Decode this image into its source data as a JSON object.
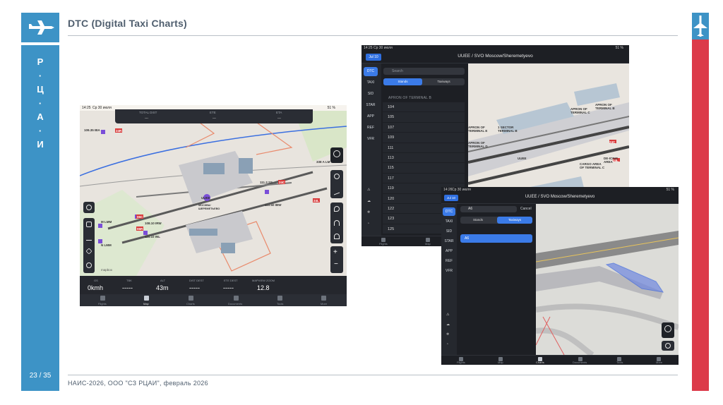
{
  "slide": {
    "title": "DTC (Digital Taxi Charts)",
    "side_letters": [
      "Р",
      "·",
      "Ц",
      "·",
      "А",
      "·",
      "И"
    ],
    "page_number": "23 / 35",
    "footer": "НАИС-2026, ООО \"СЗ РЦАИ\",  февраль 2026",
    "colors": {
      "accent_blue": "#3d93c6",
      "accent_red": "#dc3a49"
    }
  },
  "screen_map": {
    "status": {
      "time": "14:25",
      "date": "Ср 30 июля",
      "battery": "51 %"
    },
    "top_info": {
      "labels": [
        "TOTAL DIST",
        "ETE",
        "ETA"
      ],
      "values": [
        "---",
        "---",
        "---"
      ]
    },
    "map_labels": {
      "left_top": "109.35 IBA",
      "rwy1": "24R",
      "rwy2": "24C",
      "rwy3": "24L",
      "rwy4": "06C",
      "rwy5": "06R",
      "airport_code": "UUEE",
      "airport_name": "МОСКВА/ ШЕРЕМЕТЬЕВО",
      "ils1": "111.3 SS",
      "ils2": "338 A LM",
      "ils3": "110.50 IBW",
      "ils4": "108.10 IRW",
      "ils5": "110.10 INL",
      "lmm1": "M LMM",
      "lmm2": "N LMM",
      "mapbox": "mapbox"
    },
    "bottom_info": {
      "labels": [
        "GS",
        "TBK",
        "ALT",
        "DIST DEST",
        "ETE DEST",
        "MAPVIEW ZOOM"
      ],
      "values": [
        "0kmh",
        "-----",
        "43m",
        "-----",
        "-----",
        "12.8"
      ]
    },
    "tabs": [
      "Flights",
      "Map",
      "Charts",
      "Documents",
      "Tools",
      "More"
    ]
  },
  "screen_dtc": {
    "status": {
      "time": "14:25",
      "date": "Ср 30 июля",
      "battery": "51 %"
    },
    "date_button": "Jul 10",
    "header_title": "UUEE / SVO Moscow/Sheremetyevo",
    "rail": [
      "DTC",
      "TAXI",
      "SID",
      "STAR",
      "APP",
      "REF",
      "VFR"
    ],
    "search_placeholder": "Search",
    "segments": [
      "Stands",
      "Taxiways"
    ],
    "section": "APRON OF TERMINAL B",
    "stands": [
      "104",
      "105",
      "107",
      "109",
      "111",
      "113",
      "115",
      "117",
      "119",
      "120",
      "122",
      "123",
      "125"
    ],
    "map_labels": {
      "apron_b": "APRON OF TERMINAL B",
      "apron_c": "APRON OF TERMINAL C",
      "apron_e": "APRON OF TERMINAL E",
      "sector_b": "1 SECTOR TERMINAL B",
      "apron_d": "APRON OF TERMINAL D",
      "cargo": "CARGO AREA OF TERMINAL C",
      "deicing": "DE-ICING AREA",
      "uuee": "UUEE",
      "r24c": "24C",
      "r24l": "24L"
    },
    "tabs": [
      "Flights",
      "Map"
    ]
  },
  "screen_taxi": {
    "status": {
      "time": "14:26",
      "date": "Ср 30 июля",
      "battery": "51 %"
    },
    "date_button": "Jul 10",
    "header_title": "UUEE / SVO Moscow/Sheremetyevo",
    "rail": [
      "DTC",
      "TAXI",
      "SID",
      "STAR",
      "APP",
      "REF",
      "VFR"
    ],
    "search_value": "A6",
    "cancel": "Cancel",
    "segments": [
      "Stands",
      "Taxiways"
    ],
    "result": "A6",
    "tabs": [
      "Flights",
      "Map",
      "Charts",
      "Documents",
      "Tools",
      "More"
    ]
  }
}
